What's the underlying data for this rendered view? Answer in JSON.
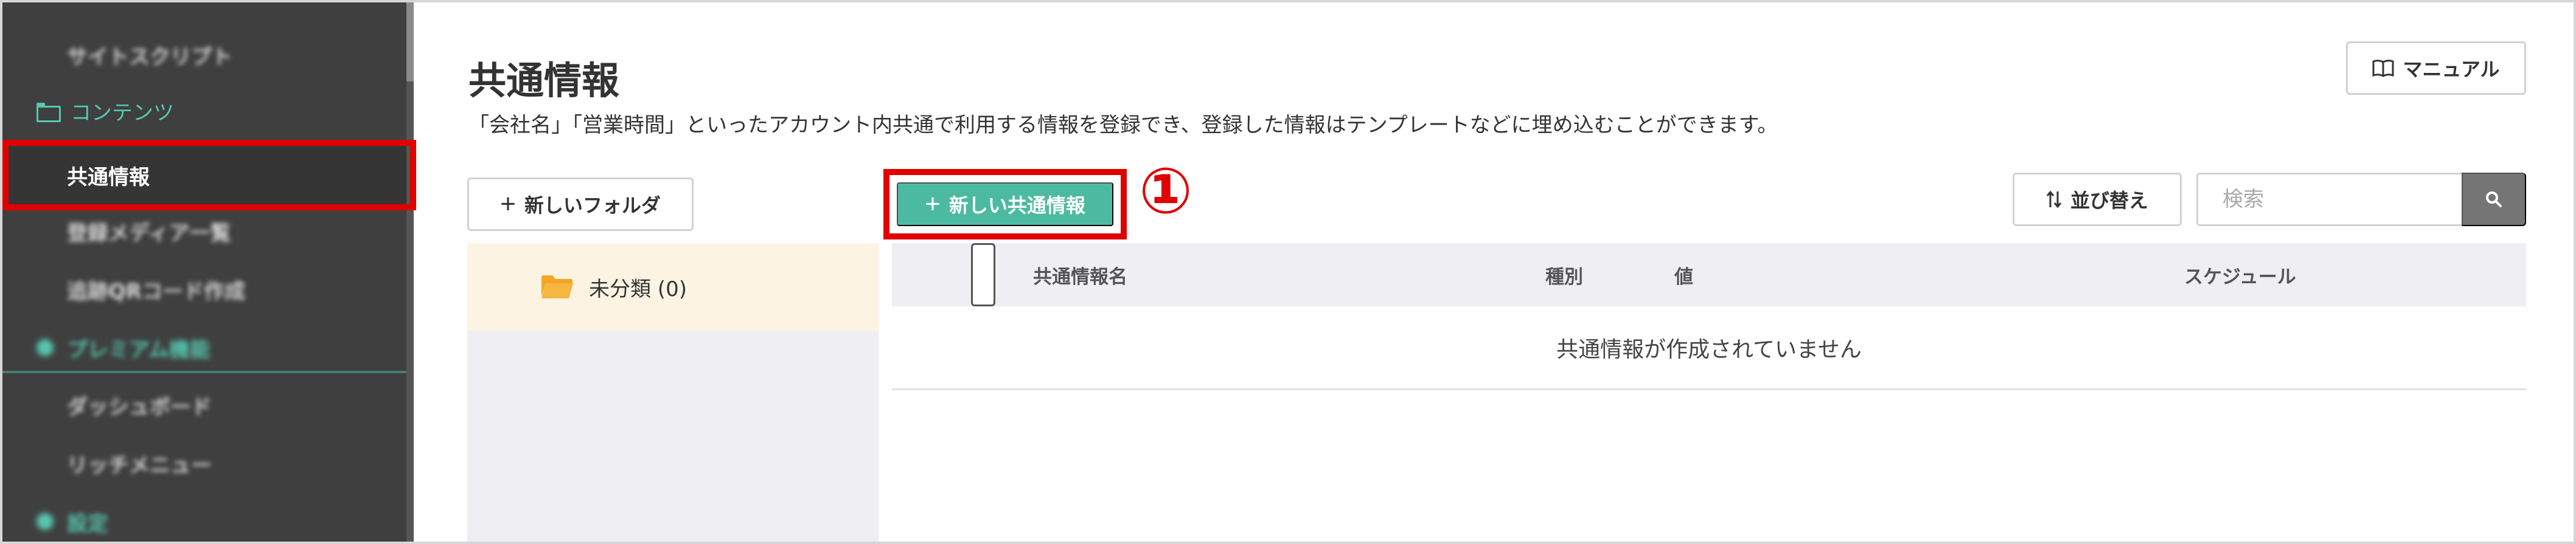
{
  "sidebar": {
    "items": [
      {
        "label": "サイトスクリプト",
        "type": "blurred"
      },
      {
        "label": "コンテンツ",
        "type": "category"
      },
      {
        "label": "共通情報",
        "type": "selected"
      },
      {
        "label": "登録メディア一覧",
        "type": "blurred"
      },
      {
        "label": "追跡QRコード作成",
        "type": "blurred"
      },
      {
        "label": "プレミアム機能",
        "type": "blurred-category"
      },
      {
        "label": "ダッシュボード",
        "type": "blurred"
      },
      {
        "label": "リッチメニュー",
        "type": "blurred"
      },
      {
        "label": "設定",
        "type": "blurred-category"
      }
    ]
  },
  "main": {
    "title": "共通情報",
    "description": "「会社名」「営業時間」といったアカウント内共通で利用する情報を登録でき、登録した情報はテンプレートなどに埋め込むことができます。",
    "manual_label": "マニュアル",
    "new_folder_label": "新しいフォルダ",
    "new_info_label": "新しい共通情報",
    "step_marker": "①",
    "sort_label": "並び替え",
    "search_placeholder": "検索",
    "folder": {
      "label": "未分類 (0)"
    },
    "table": {
      "columns": [
        "共通情報名",
        "種別",
        "値",
        "スケジュール"
      ],
      "empty_message": "共通情報が作成されていません"
    }
  },
  "colors": {
    "accent": "#4cbaa0",
    "sidebar_bg": "#3f3f3f",
    "sidebar_accent": "#56c7b0",
    "highlight": "#e00000",
    "folder_icon": "#f5a623",
    "folder_row_bg": "#fdf3e3"
  },
  "icons": {
    "manual": "book-icon",
    "sort": "sort-arrows-icon",
    "search": "search-icon",
    "folder": "folder-icon"
  }
}
